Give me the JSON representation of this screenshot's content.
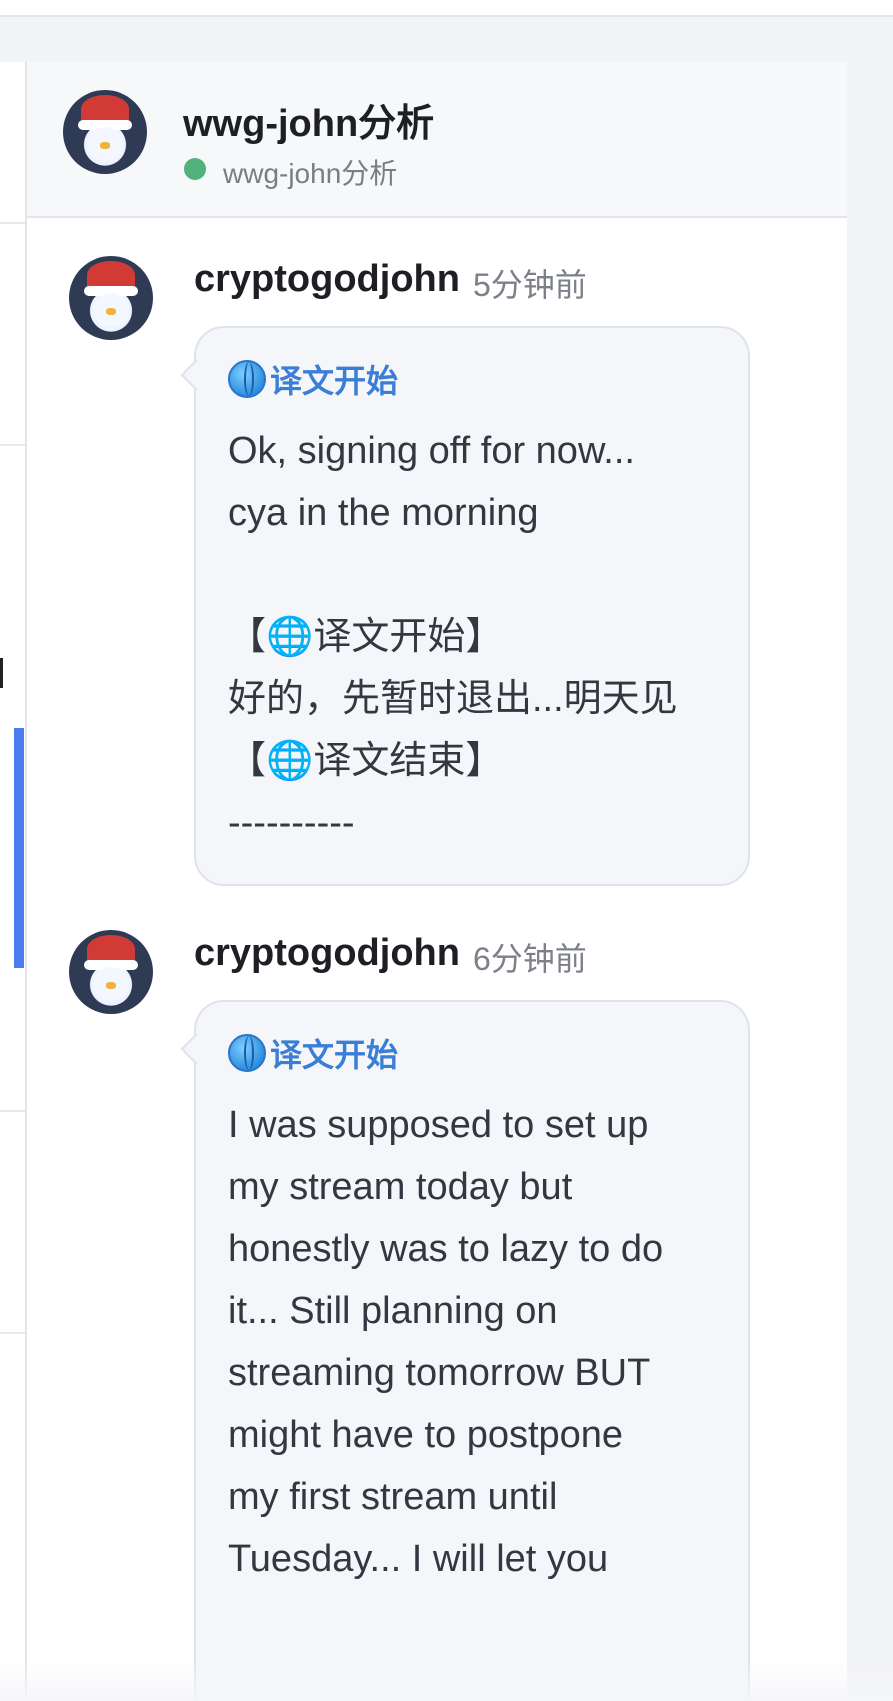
{
  "header": {
    "title": "wwg-john分析",
    "subtitle": "wwg-john分析",
    "status_color": "#52b27c"
  },
  "messages": [
    {
      "author": "cryptogodjohn",
      "time": "5分钟前",
      "tag": "译文开始",
      "text": "Ok, signing off for now...\ncya in the morning\n\n【🌐译文开始】\n好的，先暂时退出...明天见\n【🌐译文结束】\n----------"
    },
    {
      "author": "cryptogodjohn",
      "time": "6分钟前",
      "tag": "译文开始",
      "text": "I was supposed to set up\nmy stream today but\nhonestly was to lazy to do\nit... Still planning on\nstreaming tomorrow BUT\nmight have to postpone\nmy first stream until\nTuesday... I will let you"
    }
  ],
  "icons": {
    "globe": "globe-icon",
    "status": "online-dot",
    "avatar": "penguin-santa-hat-avatar"
  },
  "colors": {
    "tag": "#3b7ed6",
    "active_indicator": "#4a7ef0"
  }
}
